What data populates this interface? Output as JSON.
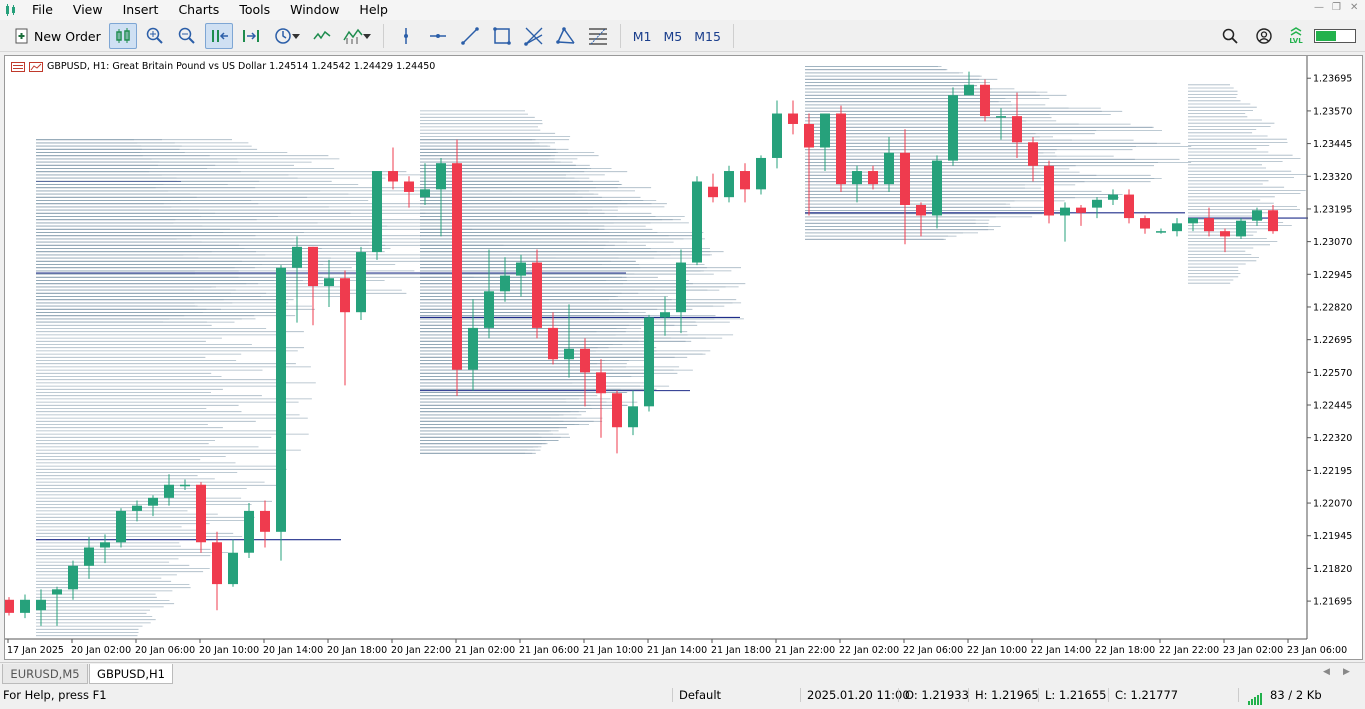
{
  "menu": {
    "items": [
      "File",
      "View",
      "Insert",
      "Charts",
      "Tools",
      "Window",
      "Help"
    ]
  },
  "toolbar": {
    "new_order_label": "New Order",
    "timeframes": [
      "M1",
      "M5",
      "M15"
    ],
    "level_badge": "LVL",
    "accent_green": "#22b14c"
  },
  "chart": {
    "symbol_line": "GBPUSD, H1:  Great Britain Pound vs US Dollar  1.24514 1.24542 1.24429 1.24450",
    "bull_color": "#26a17b",
    "bear_color": "#ef3b4e",
    "profile_color": "#8aa0b0",
    "poc_color": "#1f2d8a"
  },
  "chart_data": {
    "type": "candlestick",
    "ylim": [
      1.2155,
      1.2378
    ],
    "y_ticks": [
      "1.23695",
      "1.23570",
      "1.23445",
      "1.23320",
      "1.23195",
      "1.23070",
      "1.22945",
      "1.22820",
      "1.22695",
      "1.22570",
      "1.22445",
      "1.22320",
      "1.22195",
      "1.22070",
      "1.21945",
      "1.21820",
      "1.21695"
    ],
    "x_ticks": [
      "17 Jan 2025",
      "20 Jan 02:00",
      "20 Jan 06:00",
      "20 Jan 10:00",
      "20 Jan 14:00",
      "20 Jan 18:00",
      "20 Jan 22:00",
      "21 Jan 02:00",
      "21 Jan 06:00",
      "21 Jan 10:00",
      "21 Jan 14:00",
      "21 Jan 18:00",
      "21 Jan 22:00",
      "22 Jan 02:00",
      "22 Jan 06:00",
      "22 Jan 10:00",
      "22 Jan 14:00",
      "22 Jan 18:00",
      "22 Jan 22:00",
      "23 Jan 02:00",
      "23 Jan 06:00"
    ],
    "candles": [
      [
        1.217,
        1.2171,
        1.2164,
        1.2165
      ],
      [
        1.2165,
        1.2172,
        1.2163,
        1.217
      ],
      [
        1.2166,
        1.2174,
        1.216,
        1.217
      ],
      [
        1.2172,
        1.2175,
        1.216,
        1.2174
      ],
      [
        1.2174,
        1.2185,
        1.217,
        1.2183
      ],
      [
        1.2183,
        1.2194,
        1.2178,
        1.219
      ],
      [
        1.219,
        1.2195,
        1.2184,
        1.2192
      ],
      [
        1.2192,
        1.2205,
        1.219,
        1.2204
      ],
      [
        1.2204,
        1.2208,
        1.22,
        1.2206
      ],
      [
        1.2206,
        1.221,
        1.2202,
        1.2209
      ],
      [
        1.2209,
        1.2218,
        1.2206,
        1.2214
      ],
      [
        1.2214,
        1.2216,
        1.2212,
        1.2214
      ],
      [
        1.2214,
        1.2215,
        1.2188,
        1.2192
      ],
      [
        1.2192,
        1.2196,
        1.2166,
        1.2176
      ],
      [
        1.2176,
        1.2193,
        1.2175,
        1.2188
      ],
      [
        1.2188,
        1.2207,
        1.2186,
        1.2204
      ],
      [
        1.2204,
        1.2208,
        1.219,
        1.2196
      ],
      [
        1.2196,
        1.2298,
        1.2185,
        1.2297
      ],
      [
        1.2297,
        1.2309,
        1.2276,
        1.2305
      ],
      [
        1.2305,
        1.2305,
        1.2275,
        1.229
      ],
      [
        1.229,
        1.23,
        1.2282,
        1.2293
      ],
      [
        1.2293,
        1.2296,
        1.2252,
        1.228
      ],
      [
        1.228,
        1.2305,
        1.2277,
        1.2303
      ],
      [
        1.2303,
        1.2334,
        1.23,
        1.2334
      ],
      [
        1.2334,
        1.2343,
        1.2327,
        1.233
      ],
      [
        1.233,
        1.2332,
        1.232,
        1.2326
      ],
      [
        1.2324,
        1.2337,
        1.2321,
        1.2327
      ],
      [
        1.2327,
        1.2339,
        1.2309,
        1.2337
      ],
      [
        1.2337,
        1.2346,
        1.2248,
        1.2258
      ],
      [
        1.2258,
        1.2285,
        1.225,
        1.2274
      ],
      [
        1.2274,
        1.2304,
        1.227,
        1.2288
      ],
      [
        1.2288,
        1.2301,
        1.2284,
        1.2294
      ],
      [
        1.2294,
        1.2302,
        1.2286,
        1.2299
      ],
      [
        1.2299,
        1.2304,
        1.227,
        1.2274
      ],
      [
        1.2274,
        1.228,
        1.226,
        1.2262
      ],
      [
        1.2262,
        1.2283,
        1.2255,
        1.2266
      ],
      [
        1.2266,
        1.227,
        1.2244,
        1.2257
      ],
      [
        1.2257,
        1.2262,
        1.2232,
        1.2249
      ],
      [
        1.2249,
        1.225,
        1.2226,
        1.2236
      ],
      [
        1.2236,
        1.225,
        1.2233,
        1.2244
      ],
      [
        1.2244,
        1.2279,
        1.2242,
        1.2278
      ],
      [
        1.2278,
        1.2286,
        1.2271,
        1.228
      ],
      [
        1.228,
        1.2304,
        1.2272,
        1.2299
      ],
      [
        1.2299,
        1.2332,
        1.2298,
        1.233
      ],
      [
        1.2328,
        1.2333,
        1.2322,
        1.2324
      ],
      [
        1.2324,
        1.2336,
        1.2322,
        1.2334
      ],
      [
        1.2334,
        1.2337,
        1.2322,
        1.2327
      ],
      [
        1.2327,
        1.234,
        1.2325,
        1.2339
      ],
      [
        1.2339,
        1.2361,
        1.2335,
        1.2356
      ],
      [
        1.2356,
        1.2361,
        1.2348,
        1.2352
      ],
      [
        1.2352,
        1.2356,
        1.2317,
        1.2343
      ],
      [
        1.2343,
        1.2356,
        1.2334,
        1.2356
      ],
      [
        1.2356,
        1.2359,
        1.2326,
        1.2329
      ],
      [
        1.2329,
        1.2336,
        1.2322,
        1.2334
      ],
      [
        1.2334,
        1.2336,
        1.2327,
        1.2329
      ],
      [
        1.2329,
        1.2347,
        1.2326,
        1.2341
      ],
      [
        1.2341,
        1.235,
        1.2306,
        1.2321
      ],
      [
        1.2321,
        1.2322,
        1.2309,
        1.2317
      ],
      [
        1.2317,
        1.234,
        1.2312,
        1.2338
      ],
      [
        1.2338,
        1.2366,
        1.2336,
        1.2363
      ],
      [
        1.2363,
        1.2372,
        1.2363,
        1.2367
      ],
      [
        1.2367,
        1.2369,
        1.2353,
        1.2355
      ],
      [
        1.2355,
        1.2358,
        1.2346,
        1.2355
      ],
      [
        1.2355,
        1.2364,
        1.2339,
        1.2345
      ],
      [
        1.2345,
        1.2347,
        1.233,
        1.2336
      ],
      [
        1.2336,
        1.2338,
        1.2314,
        1.2317
      ],
      [
        1.2317,
        1.2322,
        1.2307,
        1.232
      ],
      [
        1.232,
        1.2321,
        1.2313,
        1.2318
      ],
      [
        1.232,
        1.2324,
        1.2316,
        1.2323
      ],
      [
        1.2323,
        1.2327,
        1.2321,
        1.2325
      ],
      [
        1.2325,
        1.2327,
        1.2314,
        1.2316
      ],
      [
        1.2316,
        1.2317,
        1.231,
        1.2312
      ],
      [
        1.2311,
        1.2312,
        1.231,
        1.2311
      ],
      [
        1.2311,
        1.2316,
        1.2309,
        1.2314
      ],
      [
        1.2314,
        1.2316,
        1.2311,
        1.2316
      ],
      [
        1.2316,
        1.232,
        1.2309,
        1.2311
      ],
      [
        1.2311,
        1.2312,
        1.2303,
        1.2309
      ],
      [
        1.2309,
        1.2316,
        1.2308,
        1.2315
      ],
      [
        1.2315,
        1.232,
        1.2313,
        1.2319
      ],
      [
        1.2319,
        1.2321,
        1.231,
        1.2311
      ]
    ]
  },
  "tabs": [
    {
      "label": "EURUSD,M5",
      "active": false
    },
    {
      "label": "GBPUSD,H1",
      "active": true
    }
  ],
  "status": {
    "help": "For Help, press F1",
    "profile": "Default",
    "datetime": "2025.01.20 11:00",
    "open": "O: 1.21933",
    "high": "H: 1.21965",
    "low": "L: 1.21655",
    "close": "C: 1.21777",
    "traffic": "83 / 2 Kb"
  }
}
